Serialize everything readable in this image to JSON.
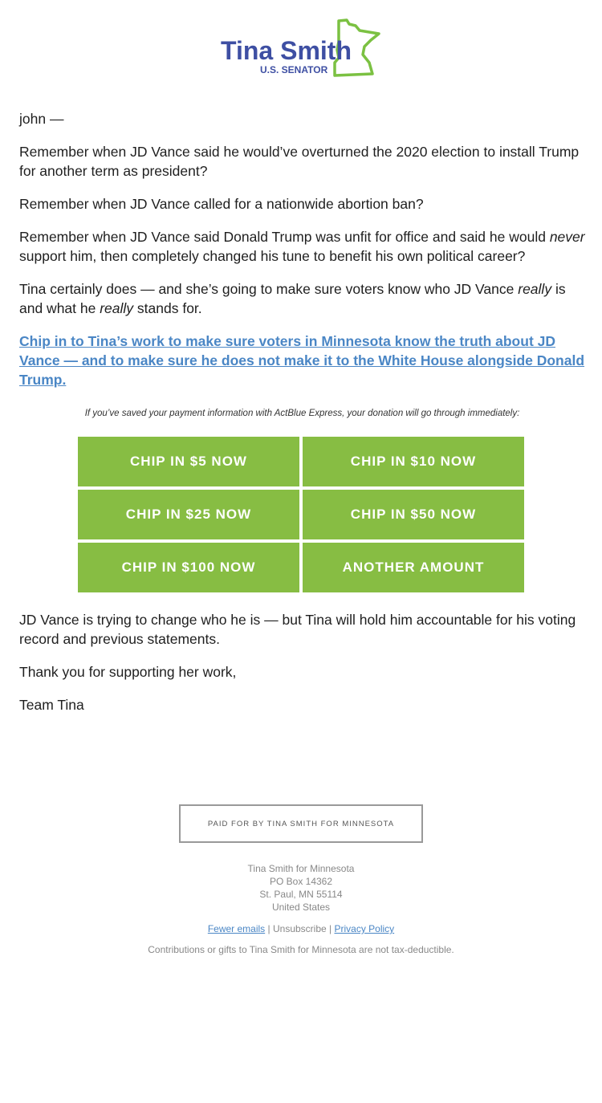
{
  "header": {
    "logo_name": "Tina Smith",
    "logo_subtitle": "U.S. SENATOR",
    "logo_icon": "minnesota-outline-icon",
    "colors": {
      "name": "#3e4fa3",
      "outline": "#7bc142"
    }
  },
  "body": {
    "greeting": "john —",
    "paragraphs": [
      "Remember when JD Vance said he would’ve overturned the 2020 election to install Trump for another term as president?",
      "Remember when JD Vance called for a nationwide abortion ban?"
    ],
    "p3": {
      "before": "Remember when JD Vance said Donald Trump was unfit for office and said he would ",
      "em": "never",
      "after": " support him, then completely changed his tune to benefit his own political career?"
    },
    "p4": {
      "a": "Tina certainly does — and she’s going to make sure voters know who JD Vance ",
      "em1": "really",
      "b": " is and what he ",
      "em2": "really",
      "c": " stands for."
    },
    "cta_link": "Chip in to Tina’s work to make sure voters in Minnesota know the truth about JD Vance — and to make sure he does not make it to the White House alongside Donald Trump.",
    "express_note": "If you’ve saved your payment information with ActBlue Express, your donation will go through immediately:",
    "buttons": [
      {
        "label": "CHIP IN $5 NOW"
      },
      {
        "label": "CHIP IN $10 NOW"
      },
      {
        "label": "CHIP IN $25 NOW"
      },
      {
        "label": "CHIP IN $50 NOW"
      },
      {
        "label": "CHIP IN $100 NOW"
      },
      {
        "label": "ANOTHER AMOUNT"
      }
    ],
    "button_color": "#87bd43",
    "closing": [
      "JD Vance is trying to change who he is — but Tina will hold him accountable for his voting record and previous statements.",
      "Thank you for supporting her work,",
      "Team Tina"
    ]
  },
  "footer": {
    "paid_for": "PAID FOR BY TINA SMITH FOR MINNESOTA",
    "address": [
      "Tina Smith for Minnesota",
      "PO Box 14362",
      "St. Paul, MN 55114",
      "United States"
    ],
    "links": {
      "fewer_emails": "Fewer emails",
      "sep": " | ",
      "unsubscribe": "Unsubscribe",
      "privacy": "Privacy Policy"
    },
    "disclaimer": "Contributions or gifts to Tina Smith for Minnesota are not tax-deductible."
  }
}
